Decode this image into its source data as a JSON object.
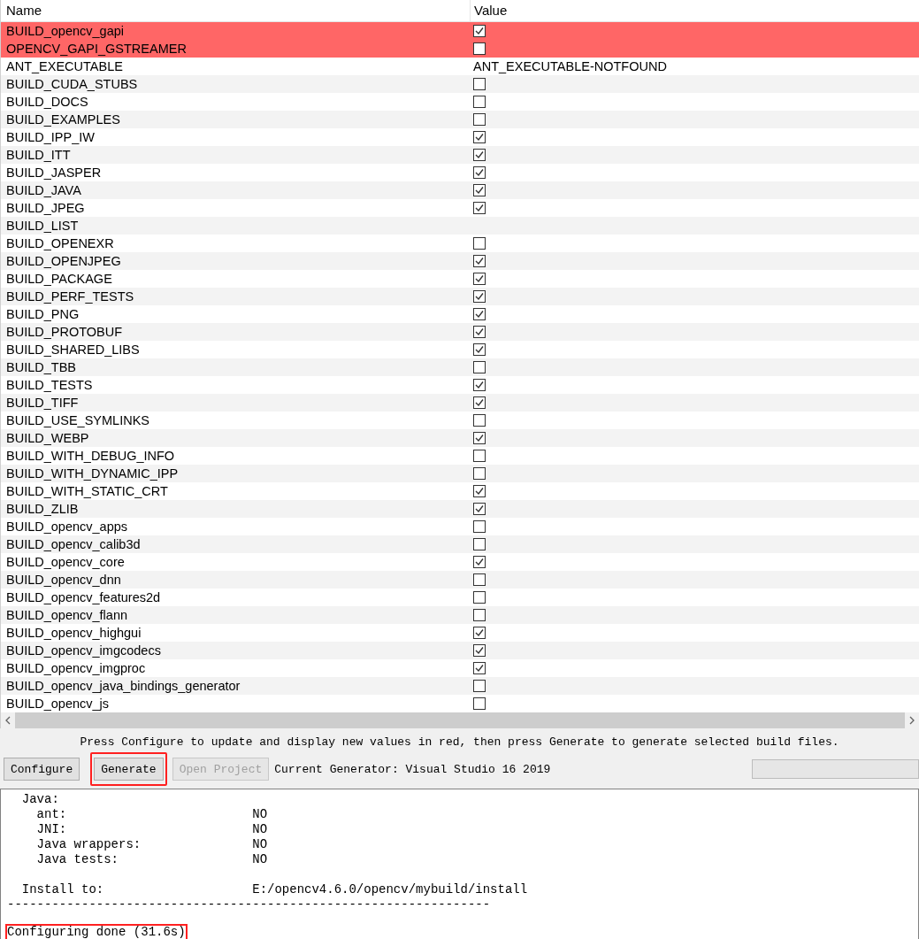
{
  "table": {
    "columns": [
      "Name",
      "Value"
    ],
    "rows": [
      {
        "name": "BUILD_opencv_gapi",
        "kind": "bool",
        "checked": true,
        "is_new": true
      },
      {
        "name": "OPENCV_GAPI_GSTREAMER",
        "kind": "bool",
        "checked": false,
        "is_new": true
      },
      {
        "name": "ANT_EXECUTABLE",
        "kind": "text",
        "value": "ANT_EXECUTABLE-NOTFOUND",
        "is_new": false
      },
      {
        "name": "BUILD_CUDA_STUBS",
        "kind": "bool",
        "checked": false,
        "is_new": false
      },
      {
        "name": "BUILD_DOCS",
        "kind": "bool",
        "checked": false,
        "is_new": false
      },
      {
        "name": "BUILD_EXAMPLES",
        "kind": "bool",
        "checked": false,
        "is_new": false
      },
      {
        "name": "BUILD_IPP_IW",
        "kind": "bool",
        "checked": true,
        "is_new": false
      },
      {
        "name": "BUILD_ITT",
        "kind": "bool",
        "checked": true,
        "is_new": false
      },
      {
        "name": "BUILD_JASPER",
        "kind": "bool",
        "checked": true,
        "is_new": false
      },
      {
        "name": "BUILD_JAVA",
        "kind": "bool",
        "checked": true,
        "is_new": false
      },
      {
        "name": "BUILD_JPEG",
        "kind": "bool",
        "checked": true,
        "is_new": false
      },
      {
        "name": "BUILD_LIST",
        "kind": "empty",
        "is_new": false
      },
      {
        "name": "BUILD_OPENEXR",
        "kind": "bool",
        "checked": false,
        "is_new": false
      },
      {
        "name": "BUILD_OPENJPEG",
        "kind": "bool",
        "checked": true,
        "is_new": false
      },
      {
        "name": "BUILD_PACKAGE",
        "kind": "bool",
        "checked": true,
        "is_new": false
      },
      {
        "name": "BUILD_PERF_TESTS",
        "kind": "bool",
        "checked": true,
        "is_new": false
      },
      {
        "name": "BUILD_PNG",
        "kind": "bool",
        "checked": true,
        "is_new": false
      },
      {
        "name": "BUILD_PROTOBUF",
        "kind": "bool",
        "checked": true,
        "is_new": false
      },
      {
        "name": "BUILD_SHARED_LIBS",
        "kind": "bool",
        "checked": true,
        "is_new": false
      },
      {
        "name": "BUILD_TBB",
        "kind": "bool",
        "checked": false,
        "is_new": false
      },
      {
        "name": "BUILD_TESTS",
        "kind": "bool",
        "checked": true,
        "is_new": false
      },
      {
        "name": "BUILD_TIFF",
        "kind": "bool",
        "checked": true,
        "is_new": false
      },
      {
        "name": "BUILD_USE_SYMLINKS",
        "kind": "bool",
        "checked": false,
        "is_new": false
      },
      {
        "name": "BUILD_WEBP",
        "kind": "bool",
        "checked": true,
        "is_new": false
      },
      {
        "name": "BUILD_WITH_DEBUG_INFO",
        "kind": "bool",
        "checked": false,
        "is_new": false
      },
      {
        "name": "BUILD_WITH_DYNAMIC_IPP",
        "kind": "bool",
        "checked": false,
        "is_new": false
      },
      {
        "name": "BUILD_WITH_STATIC_CRT",
        "kind": "bool",
        "checked": true,
        "is_new": false
      },
      {
        "name": "BUILD_ZLIB",
        "kind": "bool",
        "checked": true,
        "is_new": false
      },
      {
        "name": "BUILD_opencv_apps",
        "kind": "bool",
        "checked": false,
        "is_new": false
      },
      {
        "name": "BUILD_opencv_calib3d",
        "kind": "bool",
        "checked": false,
        "is_new": false
      },
      {
        "name": "BUILD_opencv_core",
        "kind": "bool",
        "checked": true,
        "is_new": false
      },
      {
        "name": "BUILD_opencv_dnn",
        "kind": "bool",
        "checked": false,
        "is_new": false
      },
      {
        "name": "BUILD_opencv_features2d",
        "kind": "bool",
        "checked": false,
        "is_new": false
      },
      {
        "name": "BUILD_opencv_flann",
        "kind": "bool",
        "checked": false,
        "is_new": false
      },
      {
        "name": "BUILD_opencv_highgui",
        "kind": "bool",
        "checked": true,
        "is_new": false
      },
      {
        "name": "BUILD_opencv_imgcodecs",
        "kind": "bool",
        "checked": true,
        "is_new": false
      },
      {
        "name": "BUILD_opencv_imgproc",
        "kind": "bool",
        "checked": true,
        "is_new": false
      },
      {
        "name": "BUILD_opencv_java_bindings_generator",
        "kind": "bool",
        "checked": false,
        "is_new": false
      },
      {
        "name": "BUILD_opencv_js",
        "kind": "bool",
        "checked": false,
        "is_new": false
      }
    ]
  },
  "hint": "Press Configure to update and display new values in red, then press Generate to generate selected build files.",
  "buttons": [
    {
      "label": "Configure",
      "disabled": false,
      "highlighted": false
    },
    {
      "label": "Generate",
      "disabled": false,
      "highlighted": true
    },
    {
      "label": "Open Project",
      "disabled": true,
      "highlighted": false
    }
  ],
  "generator": "Current Generator: Visual Studio 16 2019",
  "progress": {
    "level": 0
  },
  "log": {
    "blocks": [
      [
        "  Java:",
        "    ant:                         NO",
        "    JNI:                         NO",
        "    Java wrappers:               NO",
        "    Java tests:                  NO"
      ],
      [
        "  Install to:                    E:/opencv4.6.0/opencv/mybuild/install",
        "-----------------------------------------------------------------"
      ]
    ],
    "status": {
      "text": "Configuring done (31.6s)",
      "highlighted": true
    }
  }
}
